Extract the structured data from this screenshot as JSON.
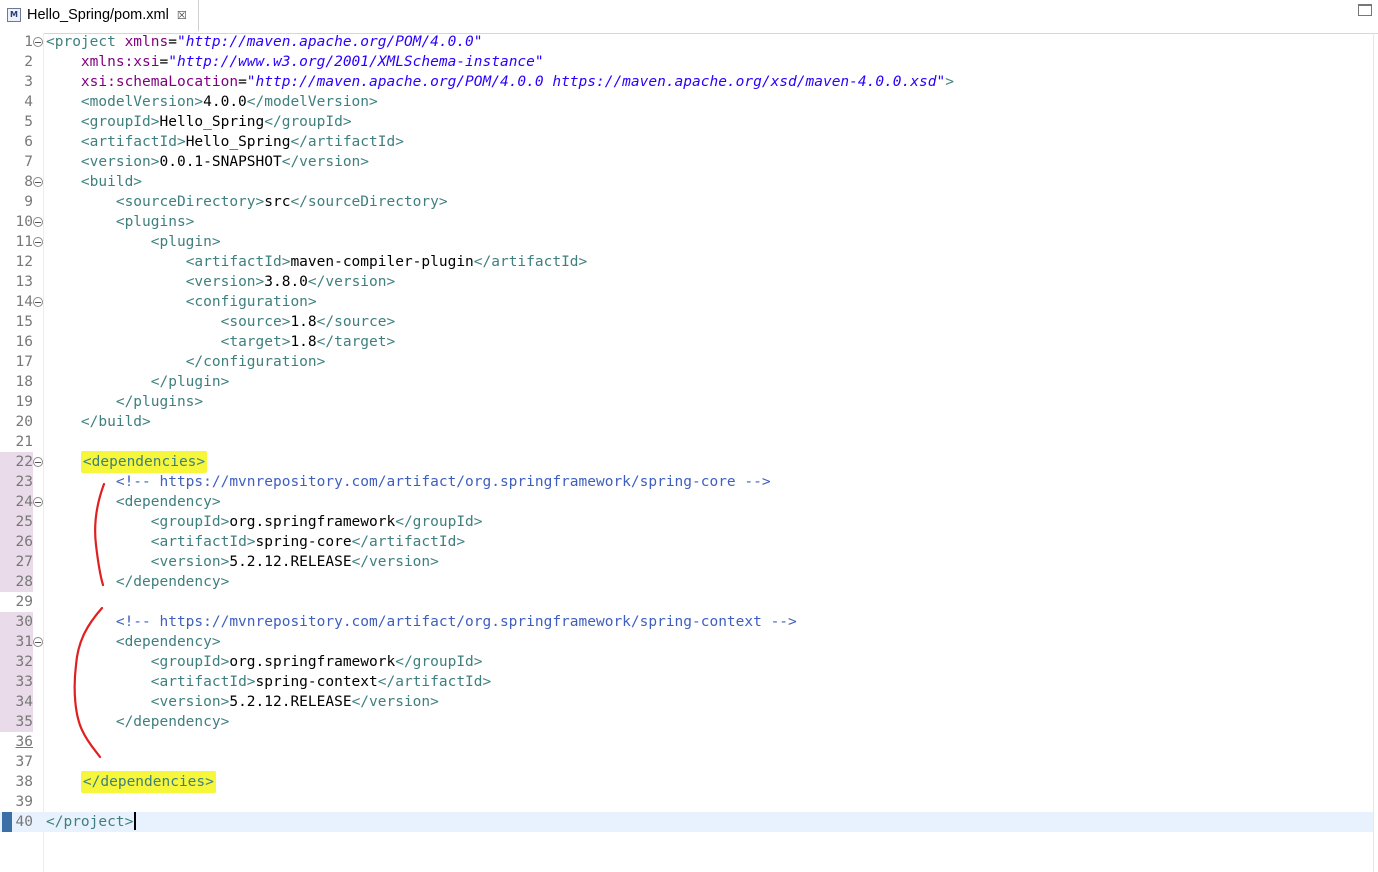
{
  "tab": {
    "title": "Hello_Spring/pom.xml",
    "icon": "M",
    "close": "☒"
  },
  "lines": [
    {
      "n": "1",
      "indent": "",
      "tokens": [
        [
          "t",
          "<project "
        ],
        [
          "a",
          "xmlns"
        ],
        [
          "tx",
          "="
        ],
        [
          "v",
          "\"http://maven.apache.org/POM/4.0.0\""
        ]
      ]
    },
    {
      "n": "2",
      "indent": "    ",
      "tokens": [
        [
          "a",
          "xmlns:xsi"
        ],
        [
          "tx",
          "="
        ],
        [
          "v",
          "\"http://www.w3.org/2001/XMLSchema-instance\""
        ]
      ]
    },
    {
      "n": "3",
      "indent": "    ",
      "tokens": [
        [
          "a",
          "xsi:schemaLocation"
        ],
        [
          "tx",
          "="
        ],
        [
          "v",
          "\"http://maven.apache.org/POM/4.0.0 https://maven.apache.org/xsd/maven-4.0.0.xsd\""
        ],
        [
          "t",
          ">"
        ]
      ]
    },
    {
      "n": "4",
      "indent": "    ",
      "tokens": [
        [
          "t",
          "<modelVersion>"
        ],
        [
          "tx",
          "4.0.0"
        ],
        [
          "t",
          "</modelVersion>"
        ]
      ]
    },
    {
      "n": "5",
      "indent": "    ",
      "tokens": [
        [
          "t",
          "<groupId>"
        ],
        [
          "tx",
          "Hello_Spring"
        ],
        [
          "t",
          "</groupId>"
        ]
      ]
    },
    {
      "n": "6",
      "indent": "    ",
      "tokens": [
        [
          "t",
          "<artifactId>"
        ],
        [
          "tx",
          "Hello_Spring"
        ],
        [
          "t",
          "</artifactId>"
        ]
      ]
    },
    {
      "n": "7",
      "indent": "    ",
      "tokens": [
        [
          "t",
          "<version>"
        ],
        [
          "tx",
          "0.0.1-SNAPSHOT"
        ],
        [
          "t",
          "</version>"
        ]
      ]
    },
    {
      "n": "8",
      "indent": "    ",
      "tokens": [
        [
          "t",
          "<build>"
        ]
      ]
    },
    {
      "n": "9",
      "indent": "        ",
      "tokens": [
        [
          "t",
          "<sourceDirectory>"
        ],
        [
          "tx",
          "src"
        ],
        [
          "t",
          "</sourceDirectory>"
        ]
      ]
    },
    {
      "n": "10",
      "indent": "        ",
      "tokens": [
        [
          "t",
          "<plugins>"
        ]
      ]
    },
    {
      "n": "11",
      "indent": "            ",
      "tokens": [
        [
          "t",
          "<plugin>"
        ]
      ]
    },
    {
      "n": "12",
      "indent": "                ",
      "tokens": [
        [
          "t",
          "<artifactId>"
        ],
        [
          "tx",
          "maven-compiler-plugin"
        ],
        [
          "t",
          "</artifactId>"
        ]
      ]
    },
    {
      "n": "13",
      "indent": "                ",
      "tokens": [
        [
          "t",
          "<version>"
        ],
        [
          "tx",
          "3.8.0"
        ],
        [
          "t",
          "</version>"
        ]
      ]
    },
    {
      "n": "14",
      "indent": "                ",
      "tokens": [
        [
          "t",
          "<configuration>"
        ]
      ]
    },
    {
      "n": "15",
      "indent": "                    ",
      "tokens": [
        [
          "t",
          "<source>"
        ],
        [
          "tx",
          "1.8"
        ],
        [
          "t",
          "</source>"
        ]
      ]
    },
    {
      "n": "16",
      "indent": "                    ",
      "tokens": [
        [
          "t",
          "<target>"
        ],
        [
          "tx",
          "1.8"
        ],
        [
          "t",
          "</target>"
        ]
      ]
    },
    {
      "n": "17",
      "indent": "                ",
      "tokens": [
        [
          "t",
          "</configuration>"
        ]
      ]
    },
    {
      "n": "18",
      "indent": "            ",
      "tokens": [
        [
          "t",
          "</plugin>"
        ]
      ]
    },
    {
      "n": "19",
      "indent": "        ",
      "tokens": [
        [
          "t",
          "</plugins>"
        ]
      ]
    },
    {
      "n": "20",
      "indent": "    ",
      "tokens": [
        [
          "t",
          "</build>"
        ]
      ]
    },
    {
      "n": "21",
      "indent": "",
      "tokens": []
    },
    {
      "n": "22",
      "indent": "    ",
      "tokens": [
        [
          "t hl",
          "<dependencies>"
        ]
      ]
    },
    {
      "n": "23",
      "indent": "        ",
      "tokens": [
        [
          "c",
          "<!-- https://mvnrepository.com/artifact/org.springframework/spring-core -->"
        ]
      ]
    },
    {
      "n": "24",
      "indent": "        ",
      "tokens": [
        [
          "t",
          "<dependency>"
        ]
      ]
    },
    {
      "n": "25",
      "indent": "            ",
      "tokens": [
        [
          "t",
          "<groupId>"
        ],
        [
          "tx",
          "org.springframework"
        ],
        [
          "t",
          "</groupId>"
        ]
      ]
    },
    {
      "n": "26",
      "indent": "            ",
      "tokens": [
        [
          "t",
          "<artifactId>"
        ],
        [
          "tx",
          "spring-core"
        ],
        [
          "t",
          "</artifactId>"
        ]
      ]
    },
    {
      "n": "27",
      "indent": "            ",
      "tokens": [
        [
          "t",
          "<version>"
        ],
        [
          "tx",
          "5.2.12.RELEASE"
        ],
        [
          "t",
          "</version>"
        ]
      ]
    },
    {
      "n": "28",
      "indent": "        ",
      "tokens": [
        [
          "t",
          "</dependency>"
        ]
      ]
    },
    {
      "n": "29",
      "indent": "",
      "tokens": []
    },
    {
      "n": "30",
      "indent": "        ",
      "tokens": [
        [
          "c",
          "<!-- https://mvnrepository.com/artifact/org.springframework/spring-context -->"
        ]
      ]
    },
    {
      "n": "31",
      "indent": "        ",
      "tokens": [
        [
          "t",
          "<dependency>"
        ]
      ]
    },
    {
      "n": "32",
      "indent": "            ",
      "tokens": [
        [
          "t",
          "<groupId>"
        ],
        [
          "tx",
          "org.springframework"
        ],
        [
          "t",
          "</groupId>"
        ]
      ]
    },
    {
      "n": "33",
      "indent": "            ",
      "tokens": [
        [
          "t",
          "<artifactId>"
        ],
        [
          "tx",
          "spring-context"
        ],
        [
          "t",
          "</artifactId>"
        ]
      ]
    },
    {
      "n": "34",
      "indent": "            ",
      "tokens": [
        [
          "t",
          "<version>"
        ],
        [
          "tx",
          "5.2.12.RELEASE"
        ],
        [
          "t",
          "</version>"
        ]
      ]
    },
    {
      "n": "35",
      "indent": "        ",
      "tokens": [
        [
          "t",
          "</dependency>"
        ]
      ]
    },
    {
      "n": "36",
      "indent": "",
      "tokens": []
    },
    {
      "n": "37",
      "indent": "",
      "tokens": []
    },
    {
      "n": "38",
      "indent": "    ",
      "tokens": [
        [
          "t hl",
          "</dependencies>"
        ]
      ]
    },
    {
      "n": "39",
      "indent": "",
      "tokens": []
    },
    {
      "n": "40",
      "indent": "",
      "tokens": [
        [
          "t",
          "</project>"
        ]
      ]
    }
  ],
  "folds": [
    "1",
    "8",
    "10",
    "11",
    "14",
    "22",
    "24",
    "31"
  ],
  "marked_lines": [
    "22",
    "23",
    "24",
    "25",
    "26",
    "27",
    "28",
    "30",
    "31",
    "32",
    "33",
    "34",
    "35"
  ],
  "underlined_lines": [
    "36"
  ],
  "current_line": "40",
  "colors": {
    "tag": "#3f7f7f",
    "attribute": "#7f007f",
    "value": "#2a00ff",
    "comment": "#3f5fbf",
    "highlight": "#f6f63a",
    "annotation": "#e02020"
  }
}
